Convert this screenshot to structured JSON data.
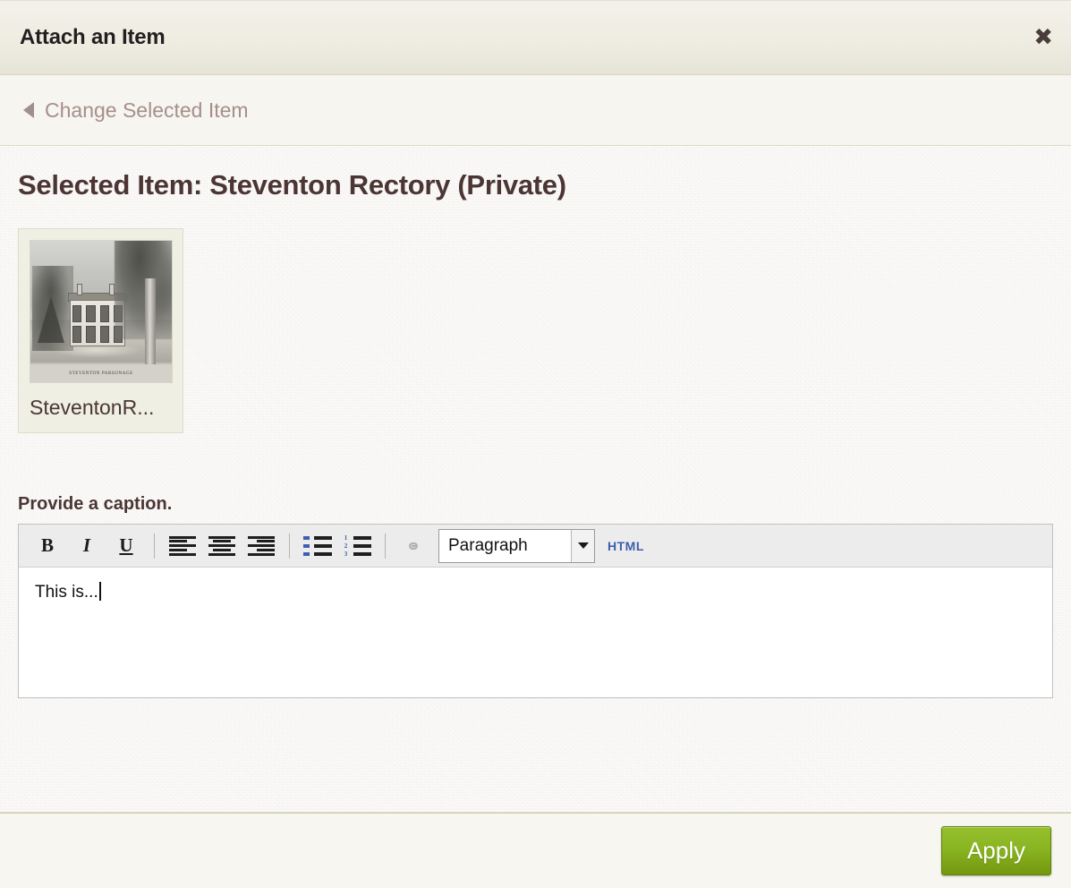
{
  "header": {
    "title": "Attach an Item",
    "close_label": "✖"
  },
  "subbar": {
    "back_label": "Change Selected Item"
  },
  "main": {
    "selected_heading": "Selected Item: Steventon Rectory (Private)",
    "thumbnail": {
      "label": "SteventonR...",
      "image_caption": "STEVENTON PARSONAGE"
    },
    "caption_label": "Provide a caption.",
    "editor": {
      "toolbar": {
        "bold": "B",
        "italic": "I",
        "underline": "U",
        "align_left": "align-left",
        "align_center": "align-center",
        "align_right": "align-right",
        "bullet_list": "bullet-list",
        "numbered_list": "numbered-list",
        "numbered_markers": [
          "1",
          "2",
          "3"
        ],
        "link": "link",
        "format_value": "Paragraph",
        "html_label": "HTML"
      },
      "content": "This is..."
    }
  },
  "footer": {
    "apply_label": "Apply"
  },
  "colors": {
    "heading": "#4b3634",
    "link": "#a58f8b",
    "apply_green": "#8ab522",
    "html_blue": "#3c5fae"
  }
}
